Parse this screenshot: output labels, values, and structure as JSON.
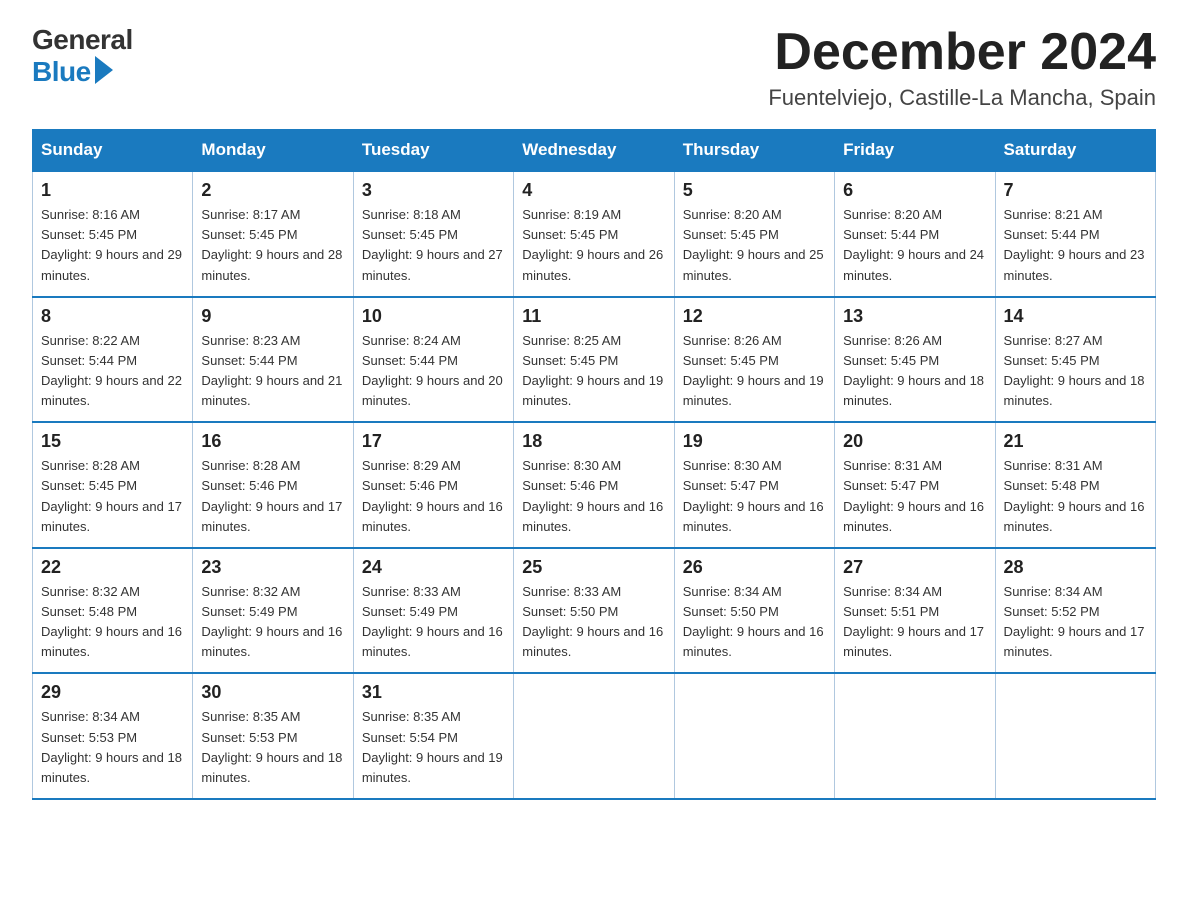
{
  "logo": {
    "general": "General",
    "blue": "Blue"
  },
  "header": {
    "month": "December 2024",
    "location": "Fuentelviejo, Castille-La Mancha, Spain"
  },
  "days_of_week": [
    "Sunday",
    "Monday",
    "Tuesday",
    "Wednesday",
    "Thursday",
    "Friday",
    "Saturday"
  ],
  "weeks": [
    [
      {
        "day": "1",
        "sunrise": "8:16 AM",
        "sunset": "5:45 PM",
        "daylight": "9 hours and 29 minutes."
      },
      {
        "day": "2",
        "sunrise": "8:17 AM",
        "sunset": "5:45 PM",
        "daylight": "9 hours and 28 minutes."
      },
      {
        "day": "3",
        "sunrise": "8:18 AM",
        "sunset": "5:45 PM",
        "daylight": "9 hours and 27 minutes."
      },
      {
        "day": "4",
        "sunrise": "8:19 AM",
        "sunset": "5:45 PM",
        "daylight": "9 hours and 26 minutes."
      },
      {
        "day": "5",
        "sunrise": "8:20 AM",
        "sunset": "5:45 PM",
        "daylight": "9 hours and 25 minutes."
      },
      {
        "day": "6",
        "sunrise": "8:20 AM",
        "sunset": "5:44 PM",
        "daylight": "9 hours and 24 minutes."
      },
      {
        "day": "7",
        "sunrise": "8:21 AM",
        "sunset": "5:44 PM",
        "daylight": "9 hours and 23 minutes."
      }
    ],
    [
      {
        "day": "8",
        "sunrise": "8:22 AM",
        "sunset": "5:44 PM",
        "daylight": "9 hours and 22 minutes."
      },
      {
        "day": "9",
        "sunrise": "8:23 AM",
        "sunset": "5:44 PM",
        "daylight": "9 hours and 21 minutes."
      },
      {
        "day": "10",
        "sunrise": "8:24 AM",
        "sunset": "5:44 PM",
        "daylight": "9 hours and 20 minutes."
      },
      {
        "day": "11",
        "sunrise": "8:25 AM",
        "sunset": "5:45 PM",
        "daylight": "9 hours and 19 minutes."
      },
      {
        "day": "12",
        "sunrise": "8:26 AM",
        "sunset": "5:45 PM",
        "daylight": "9 hours and 19 minutes."
      },
      {
        "day": "13",
        "sunrise": "8:26 AM",
        "sunset": "5:45 PM",
        "daylight": "9 hours and 18 minutes."
      },
      {
        "day": "14",
        "sunrise": "8:27 AM",
        "sunset": "5:45 PM",
        "daylight": "9 hours and 18 minutes."
      }
    ],
    [
      {
        "day": "15",
        "sunrise": "8:28 AM",
        "sunset": "5:45 PM",
        "daylight": "9 hours and 17 minutes."
      },
      {
        "day": "16",
        "sunrise": "8:28 AM",
        "sunset": "5:46 PM",
        "daylight": "9 hours and 17 minutes."
      },
      {
        "day": "17",
        "sunrise": "8:29 AM",
        "sunset": "5:46 PM",
        "daylight": "9 hours and 16 minutes."
      },
      {
        "day": "18",
        "sunrise": "8:30 AM",
        "sunset": "5:46 PM",
        "daylight": "9 hours and 16 minutes."
      },
      {
        "day": "19",
        "sunrise": "8:30 AM",
        "sunset": "5:47 PM",
        "daylight": "9 hours and 16 minutes."
      },
      {
        "day": "20",
        "sunrise": "8:31 AM",
        "sunset": "5:47 PM",
        "daylight": "9 hours and 16 minutes."
      },
      {
        "day": "21",
        "sunrise": "8:31 AM",
        "sunset": "5:48 PM",
        "daylight": "9 hours and 16 minutes."
      }
    ],
    [
      {
        "day": "22",
        "sunrise": "8:32 AM",
        "sunset": "5:48 PM",
        "daylight": "9 hours and 16 minutes."
      },
      {
        "day": "23",
        "sunrise": "8:32 AM",
        "sunset": "5:49 PM",
        "daylight": "9 hours and 16 minutes."
      },
      {
        "day": "24",
        "sunrise": "8:33 AM",
        "sunset": "5:49 PM",
        "daylight": "9 hours and 16 minutes."
      },
      {
        "day": "25",
        "sunrise": "8:33 AM",
        "sunset": "5:50 PM",
        "daylight": "9 hours and 16 minutes."
      },
      {
        "day": "26",
        "sunrise": "8:34 AM",
        "sunset": "5:50 PM",
        "daylight": "9 hours and 16 minutes."
      },
      {
        "day": "27",
        "sunrise": "8:34 AM",
        "sunset": "5:51 PM",
        "daylight": "9 hours and 17 minutes."
      },
      {
        "day": "28",
        "sunrise": "8:34 AM",
        "sunset": "5:52 PM",
        "daylight": "9 hours and 17 minutes."
      }
    ],
    [
      {
        "day": "29",
        "sunrise": "8:34 AM",
        "sunset": "5:53 PM",
        "daylight": "9 hours and 18 minutes."
      },
      {
        "day": "30",
        "sunrise": "8:35 AM",
        "sunset": "5:53 PM",
        "daylight": "9 hours and 18 minutes."
      },
      {
        "day": "31",
        "sunrise": "8:35 AM",
        "sunset": "5:54 PM",
        "daylight": "9 hours and 19 minutes."
      },
      null,
      null,
      null,
      null
    ]
  ]
}
